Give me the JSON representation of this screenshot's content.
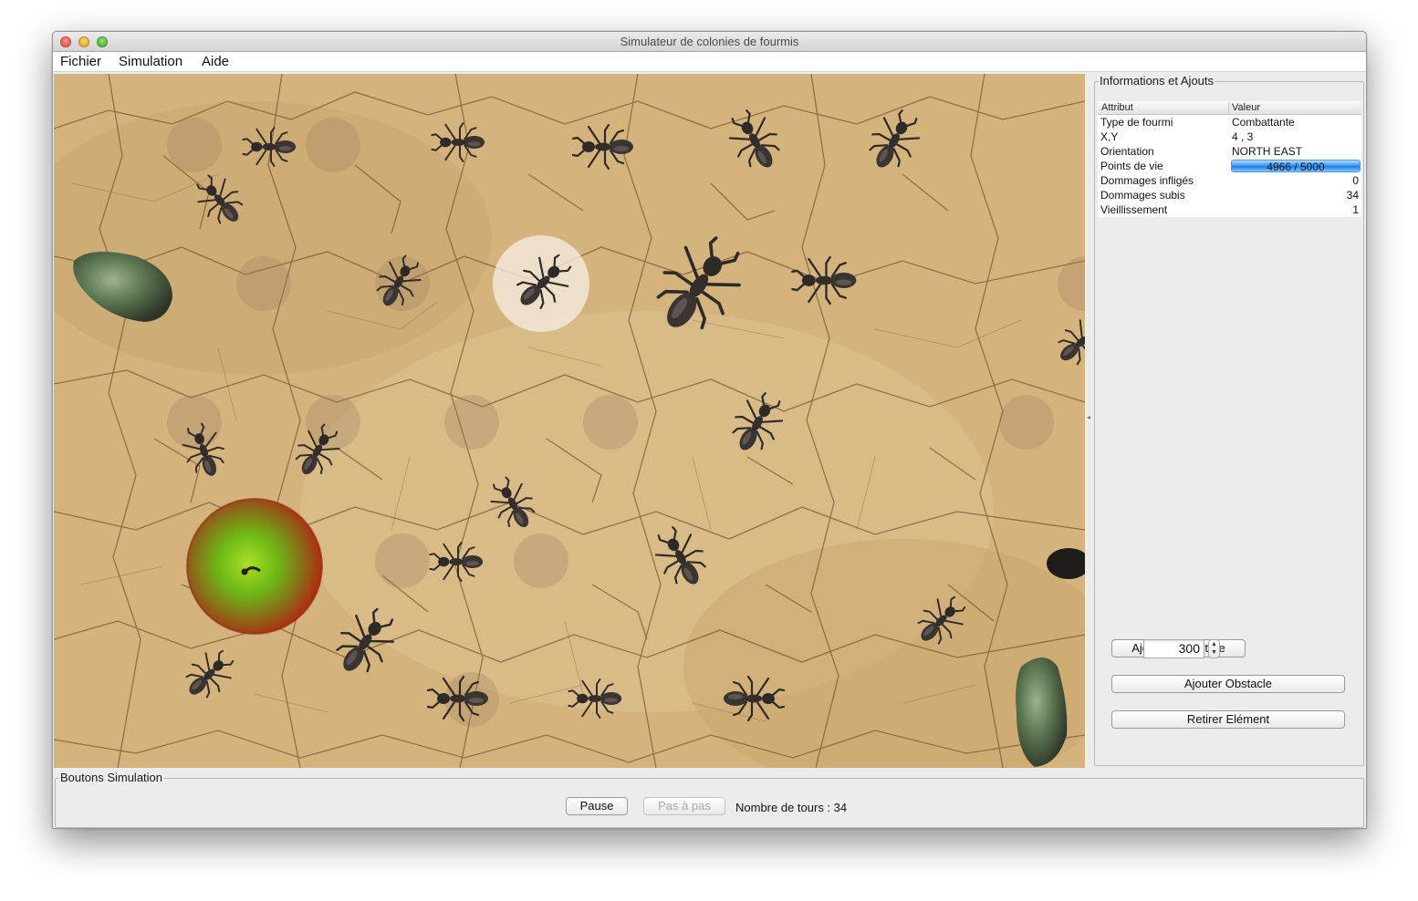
{
  "window": {
    "title": "Simulateur de colonies de fourmis"
  },
  "menu": {
    "items": [
      "Fichier",
      "Simulation",
      "Aide"
    ]
  },
  "info_panel": {
    "legend": "Informations et Ajouts",
    "columns": [
      "Attribut",
      "Valeur"
    ],
    "rows": [
      {
        "attr": "Type de fourmi",
        "value": "Combattante"
      },
      {
        "attr": "X,Y",
        "value": "4 , 3"
      },
      {
        "attr": "Orientation",
        "value": "NORTH EAST"
      },
      {
        "attr": "Points de vie",
        "value": "4966 / 5000",
        "fraction": 0.9932
      },
      {
        "attr": "Dommages infligés",
        "value": "0"
      },
      {
        "attr": "Dommages subis",
        "value": "34"
      },
      {
        "attr": "Vieillissement",
        "value": "1"
      }
    ],
    "add_food_button": "Ajouter Nourriture",
    "food_quantity": "300",
    "add_obstacle_button": "Ajouter Obstacle",
    "remove_element_button": "Retirer Elément"
  },
  "simulation_panel": {
    "legend": "Boutons Simulation",
    "pause_button": "Pause",
    "step_button": "Pas à pas",
    "turns_label": "Nombre de tours : 34"
  },
  "board": {
    "icons": [
      "ant-icon",
      "apple-icon",
      "rock-icon",
      "pheromone-spot",
      "selected-cell-highlight"
    ]
  },
  "colors": {
    "ground": "#d3b27c",
    "crack": "#7a5a34",
    "ant": "#2e2a28",
    "hp_bar": "#3f9af0"
  }
}
